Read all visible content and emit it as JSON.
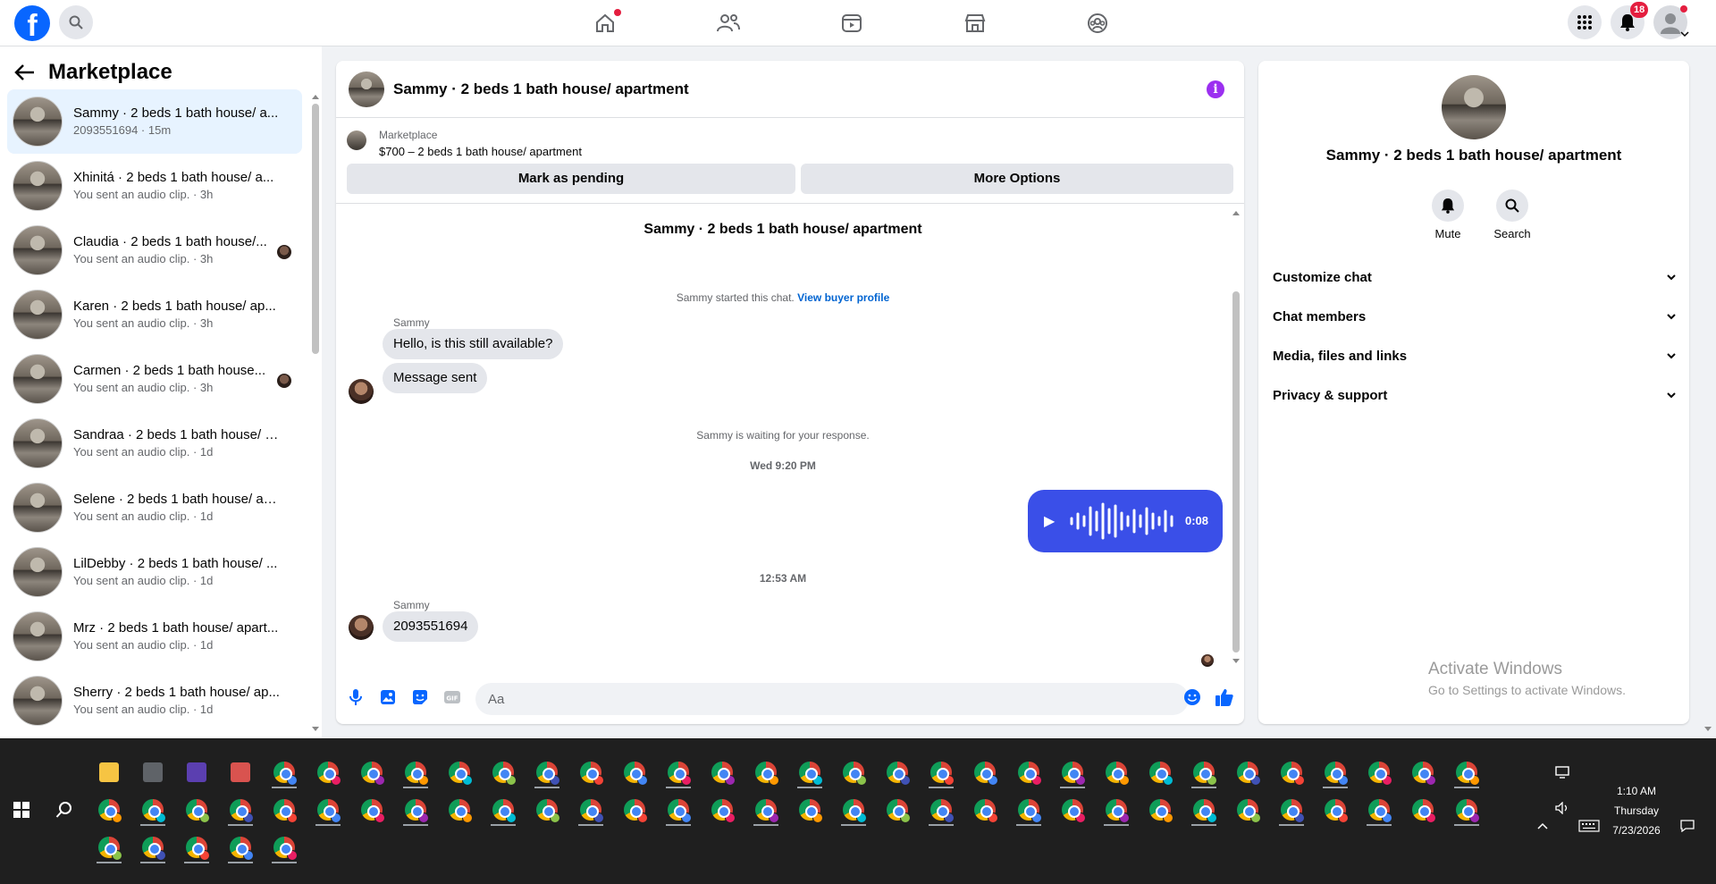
{
  "topbar": {
    "logo": "f",
    "search_icon": "search-icon",
    "nav": [
      "home-icon",
      "friends-icon",
      "video-icon",
      "marketplace-icon",
      "groups-icon"
    ],
    "menu_icon": "grid-menu-icon",
    "notifications_count": "18"
  },
  "sidebar": {
    "title": "Marketplace",
    "conversations": [
      {
        "name": "Sammy · 2 beds 1 bath house/ a...",
        "sub": "2093551694 · 15m"
      },
      {
        "name": "Xhinitá · 2 beds 1 bath house/ a...",
        "sub": "You sent an audio clip. · 3h"
      },
      {
        "name": "Claudia · 2 beds 1 bath house/...",
        "sub": "You sent an audio clip. · 3h"
      },
      {
        "name": "Karen · 2 beds 1 bath house/ ap...",
        "sub": "You sent an audio clip. · 3h"
      },
      {
        "name": "Carmen · 2 beds 1 bath house...",
        "sub": "You sent an audio clip. · 3h"
      },
      {
        "name": "Sandraa · 2 beds 1 bath house/ a...",
        "sub": "You sent an audio clip. · 1d"
      },
      {
        "name": "Selene · 2 beds 1 bath house/ ap...",
        "sub": "You sent an audio clip. · 1d"
      },
      {
        "name": "LilDebby · 2 beds 1 bath house/ ...",
        "sub": "You sent an audio clip. · 1d"
      },
      {
        "name": "Mrz · 2 beds 1 bath house/ apart...",
        "sub": "You sent an audio clip. · 1d"
      },
      {
        "name": "Sherry · 2 beds 1 bath house/ ap...",
        "sub": "You sent an audio clip. · 1d"
      }
    ]
  },
  "chat": {
    "title": "Sammy · 2 beds 1 bath house/ apartment",
    "listing_source": "Marketplace",
    "listing_price": "$700 – 2 beds 1 bath house/ apartment",
    "btn_pending": "Mark as pending",
    "btn_more": "More Options",
    "thread_title": "Sammy · 2 beds 1 bath house/ apartment",
    "started_text": "Sammy started this chat.",
    "view_profile": "View buyer profile",
    "sender1": "Sammy",
    "msg1": "Hello, is this still available?",
    "msg2": "Message sent",
    "waiting_text": "Sammy is waiting for your response.",
    "time1": "Wed 9:20 PM",
    "audio_duration": "0:08",
    "time2": "12:53 AM",
    "sender2": "Sammy",
    "msg3": "2093551694",
    "composer_placeholder": "Aa"
  },
  "info": {
    "name": "Sammy · 2 beds 1 bath house/ apartment",
    "mute_label": "Mute",
    "search_label": "Search",
    "sections": [
      "Customize chat",
      "Chat members",
      "Media, files and links",
      "Privacy & support"
    ]
  },
  "watermark": {
    "line1": "Activate Windows",
    "line2": "Go to Settings to activate Windows."
  },
  "taskbar": {
    "time": "1:10 AM",
    "day": "Thursday",
    "date": "7/23/2026"
  },
  "colors": {
    "brand": "#0866ff",
    "audio_bubble": "#3a4fe8",
    "link": "#0064d1",
    "active_row": "#e7f3ff"
  }
}
